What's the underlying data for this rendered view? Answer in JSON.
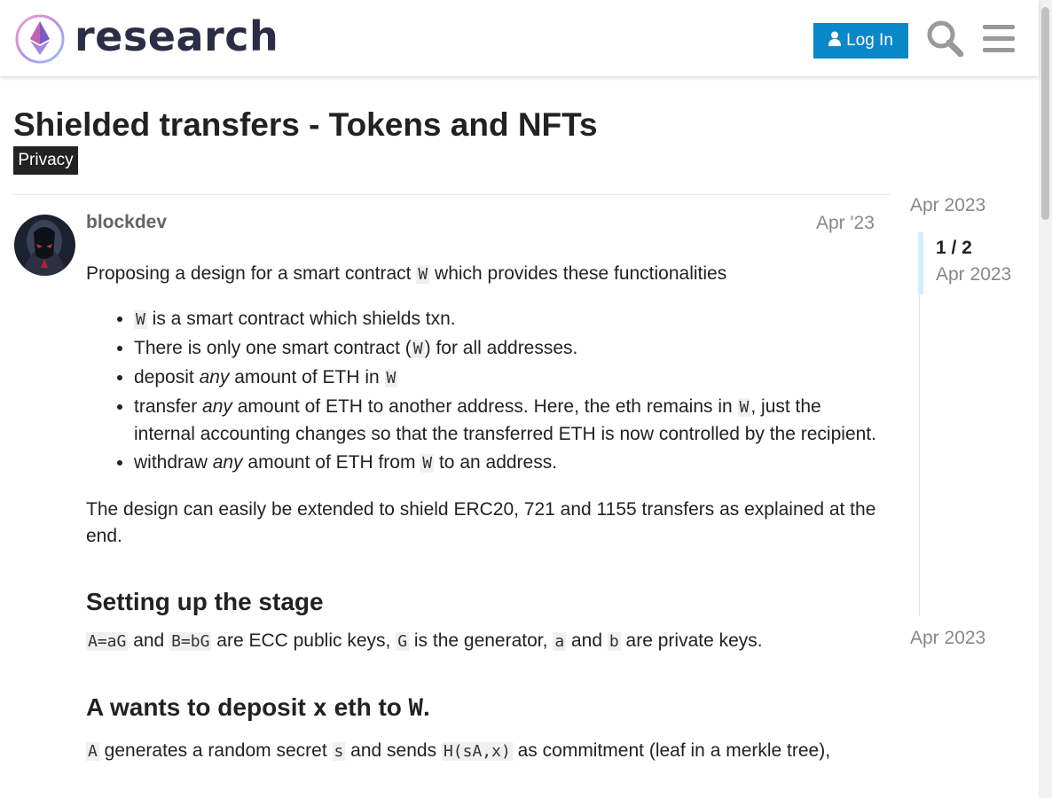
{
  "header": {
    "logo_text": "research",
    "login_label": "Log In"
  },
  "icons": {
    "logo": "ethereum-logo-icon",
    "login": "user-icon",
    "search": "search-icon",
    "menu": "hamburger-menu-icon"
  },
  "topic": {
    "title": "Shielded transfers - Tokens and NFTs",
    "category": "Privacy"
  },
  "post": {
    "username": "blockdev",
    "date": "Apr '23",
    "intro_a": "Proposing a design for a smart contract ",
    "intro_code": "W",
    "intro_b": " which provides these functionalities",
    "li1_code": "W",
    "li1_text": " is a smart contract which shields txn.",
    "li2_a": "There is only one smart contract (",
    "li2_code": "W",
    "li2_b": ") for all addresses.",
    "li3_a": "deposit ",
    "li3_em": "any",
    "li3_b": " amount of ETH in ",
    "li3_code": "W",
    "li4_a": "transfer ",
    "li4_em": "any",
    "li4_b": " amount of ETH to another address. Here, the eth remains in ",
    "li4_code": "W",
    "li4_c": ", just the internal accounting changes so that the transferred ETH is now controlled by the recipient.",
    "li5_a": "withdraw ",
    "li5_em": "any",
    "li5_b": " amount of ETH from ",
    "li5_code": "W",
    "li5_c": " to an address.",
    "extend_text": "The design can easily be extended to shield ERC20, 721 and 1155 transfers as explained at the end.",
    "h_stage": "Setting up the stage",
    "stage_code1": "A=aG",
    "stage_t1": " and ",
    "stage_code2": "B=bG",
    "stage_t2": " are ECC public keys, ",
    "stage_code3": "G",
    "stage_t3": " is the generator, ",
    "stage_code4": "a",
    "stage_t4": " and ",
    "stage_code5": "b",
    "stage_t5": " are private keys.",
    "h_deposit_a": "A wants to deposit ",
    "h_deposit_code1": "x",
    "h_deposit_b": " eth to ",
    "h_deposit_code2": "W",
    "h_deposit_c": ".",
    "dep_code1": "A",
    "dep_t1": " generates a random secret ",
    "dep_code2": "s",
    "dep_t2": " and sends ",
    "dep_code3": "H(sA,x)",
    "dep_t3": " as commitment (leaf in a merkle tree),"
  },
  "timeline": {
    "top_date": "Apr 2023",
    "counter": "1 / 2",
    "counter_date": "Apr 2023",
    "bottom_date": "Apr 2023"
  },
  "colors": {
    "login_button": "#0a88c9",
    "category_badge": "#222222",
    "timeline_handle": "#d1f0ff"
  }
}
